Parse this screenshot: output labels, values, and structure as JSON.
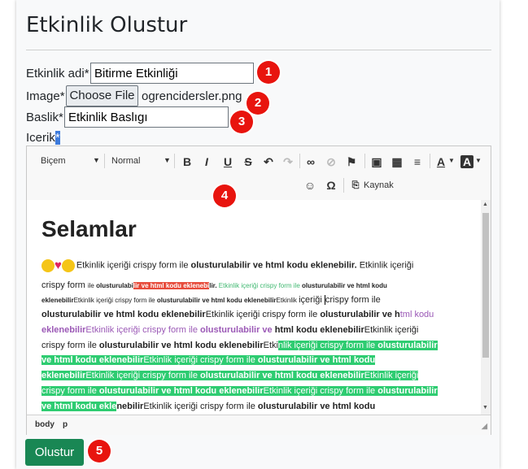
{
  "page": {
    "title": "Etkinlik Olustur"
  },
  "form": {
    "name_label": "Etkinlik adi*",
    "name_value": "Bitirme Etkinliği",
    "image_label": "Image*",
    "file_button": "Choose File",
    "file_name": "ogrencidersler.png",
    "title_label": "Baslik*",
    "title_value": "Etkinlik Baslıgı",
    "content_label": "Icerik",
    "content_required": "*",
    "submit_label": "Olustur"
  },
  "badges": [
    "1",
    "2",
    "3",
    "4",
    "5"
  ],
  "editor": {
    "format_label": "Biçem",
    "size_label": "Normal",
    "source_label": "Kaynak",
    "path": [
      "body",
      "p"
    ],
    "heading": "Selamlar",
    "lines": [
      {
        "a": "Etkinlik içeriği crispy form ile ",
        "b": "olusturulabilir ve html kodu eklenebilir.",
        "c": " Etkinlik içeriği"
      },
      {
        "a": "crispy form ",
        "b1": "ile ",
        "b2": "olusturulabi",
        "r": "lir ve html kodu eklenebi",
        "b3": "lir.",
        "g": " Etkinlik içeriği crispy form ile ",
        "b4": "olusturulabilir ve html kodu"
      },
      {
        "a": "eklenebilir",
        "b": "Etkinlik içeriği crispy form ile ",
        "c": "olusturulabilir ve html kodu eklenebilir",
        "d": "Etkinlik ",
        "e": "içeriği ",
        "f": "crispy form ile"
      },
      {
        "a": "olusturulabilir ve html kodu eklenebilir",
        "b": "Etkinlik içeriği crispy form ile ",
        "c": "olusturulabilir ve h",
        "p": "tml kodu"
      },
      {
        "p1": "eklenebilir",
        "p2": "Etkinlik içeriği crispy form ile ",
        "p3": "olusturulabilir ve ",
        "b": "html kodu eklenebilir",
        "c": "Etkinlik içeriği"
      },
      {
        "a": "crispy form ile ",
        "b": "olusturulabilir ve html kodu eklenebilir",
        "c": "Etki",
        "g1": "nlik içeriği crispy form ile ",
        "g2": "olusturulabilir"
      },
      {
        "g1": "ve html kodu eklenebilir",
        "g2": "Etkinlik içeriği crispy form ile ",
        "g3": "olusturulabilir ve html kodu"
      },
      {
        "g1": "eklenebilir",
        "g2": "Etkinlik içeriği crispy form ile ",
        "g3": "olusturulabilir ve html kodu eklenebilir",
        "g4": "Etkinlik içeriği"
      },
      {
        "g1": "crispy form ile ",
        "g2": "olusturulabilir ve html kodu eklenebilir",
        "g3": "Etkinlik içeriği crispy form ile ",
        "g4": "olusturulabilir"
      },
      {
        "g1": "ve html kodu ekle",
        "b1": "nebilir",
        "c": "Etkinlik içeriği crispy form ile ",
        "b2": "olusturulabilir ve html kodu"
      }
    ]
  }
}
